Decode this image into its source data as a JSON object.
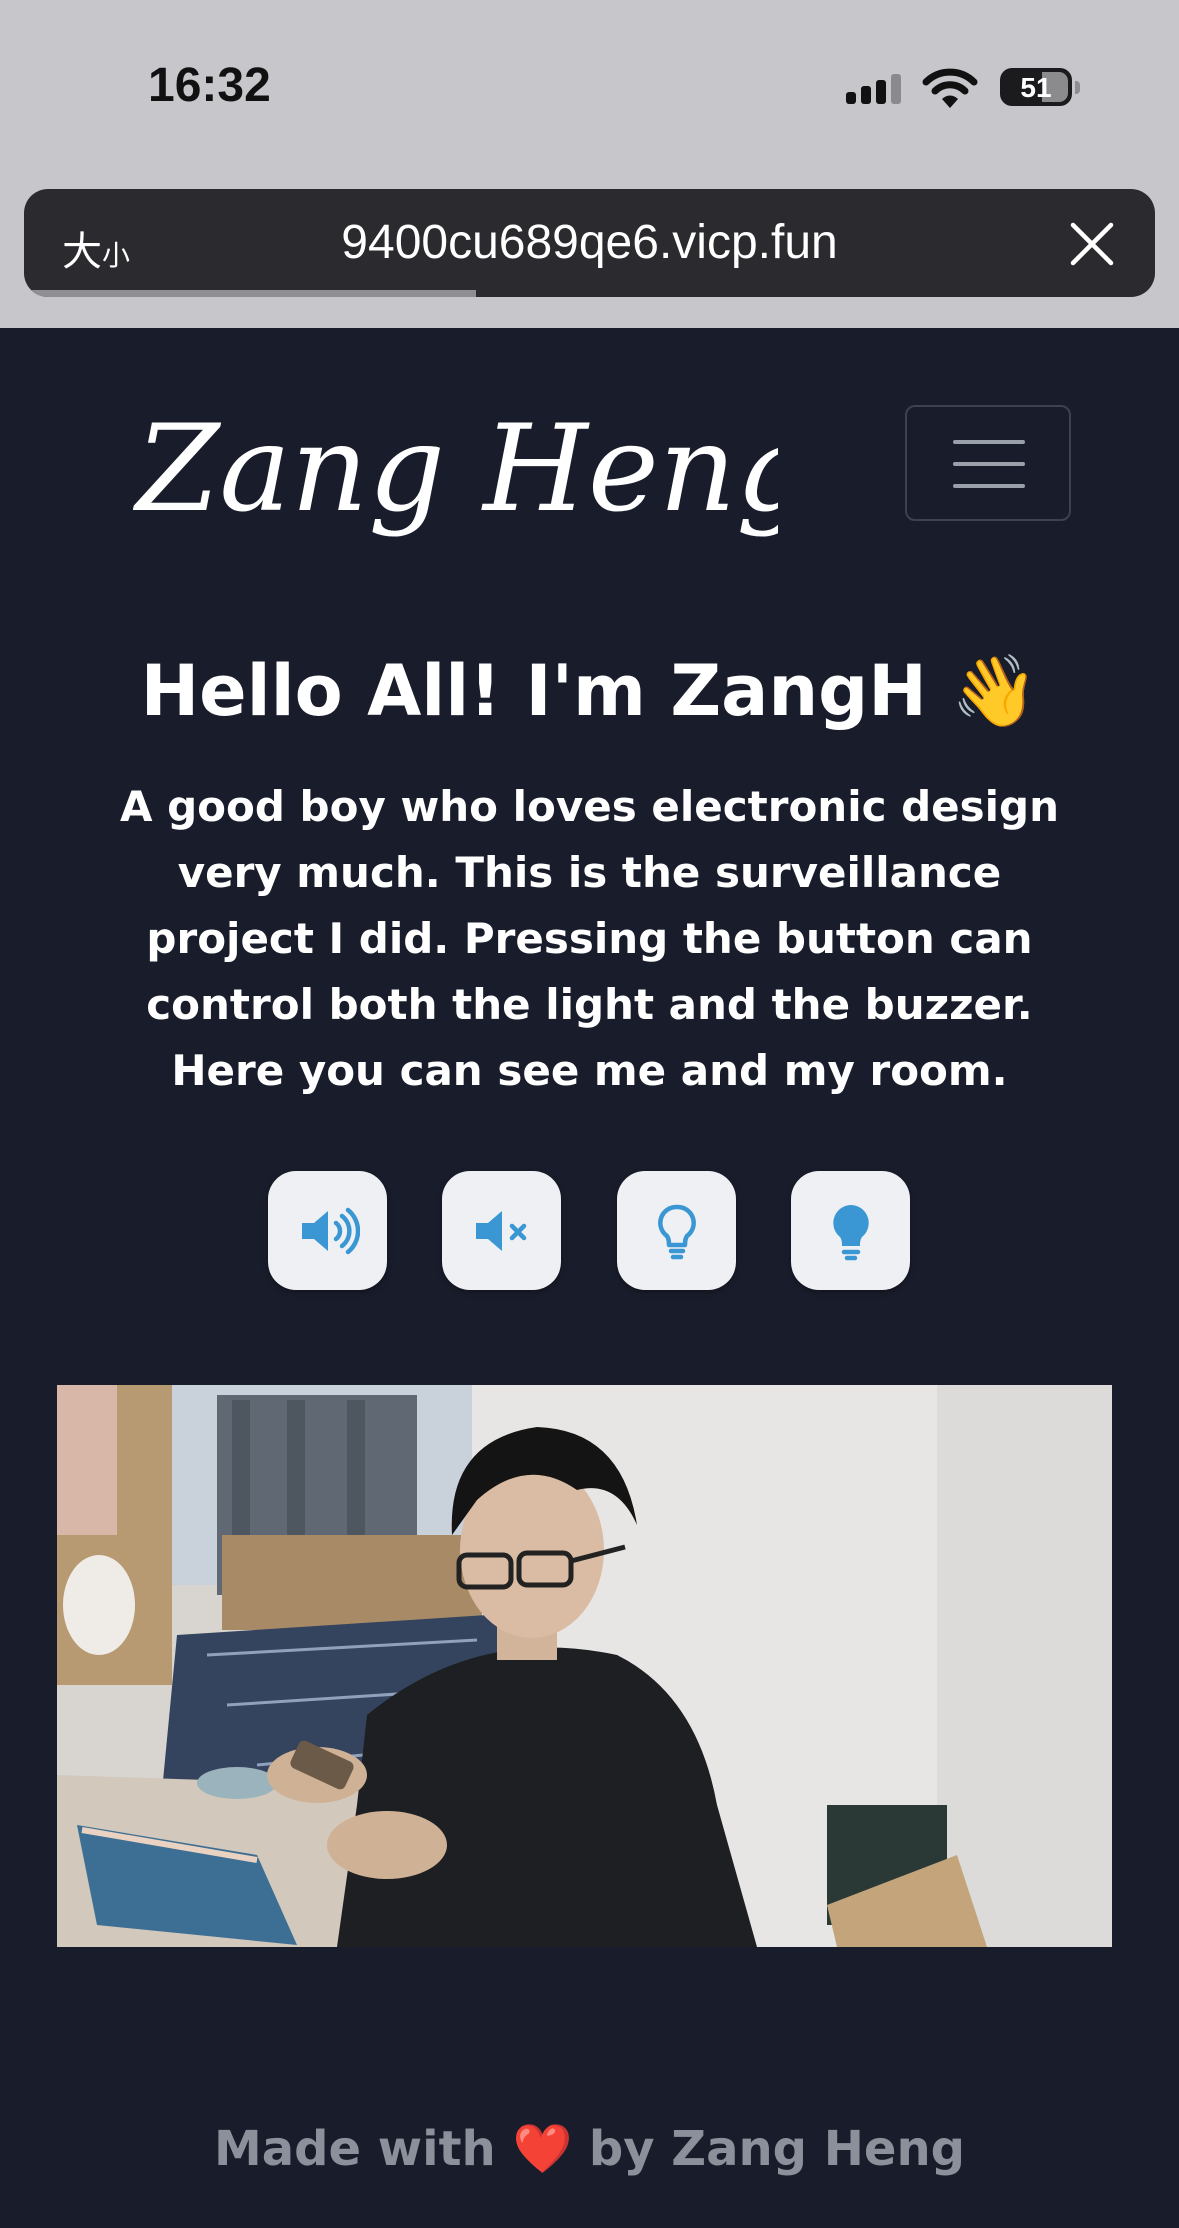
{
  "status_bar": {
    "time": "16:32",
    "battery_level": "51"
  },
  "browser": {
    "text_size_label": "大",
    "text_size_small": "小",
    "url": "9400cu689qe6.vicp.fun",
    "close_icon": "close-icon",
    "load_progress": 0.4
  },
  "navbar": {
    "logo_text": "Zang Heng",
    "menu_icon": "hamburger-icon"
  },
  "hero": {
    "title": "Hello All! I'm ZangH 👋",
    "description": "A good boy who loves electronic design very much. This is the surveillance project I did. Pressing the button can control both the light and the buzzer. Here you can see me and my room."
  },
  "controls": [
    {
      "icon": "volume-up-icon"
    },
    {
      "icon": "volume-mute-icon"
    },
    {
      "icon": "lightbulb-outline-icon"
    },
    {
      "icon": "lightbulb-filled-icon"
    }
  ],
  "colors": {
    "background": "#191d2b",
    "icon_blue": "#3a97d4",
    "button_bg": "#eef0f4",
    "footer_text": "#8c909a"
  },
  "footer": {
    "prefix": "Made with",
    "heart": "❤️",
    "suffix": "by Zang Heng"
  }
}
